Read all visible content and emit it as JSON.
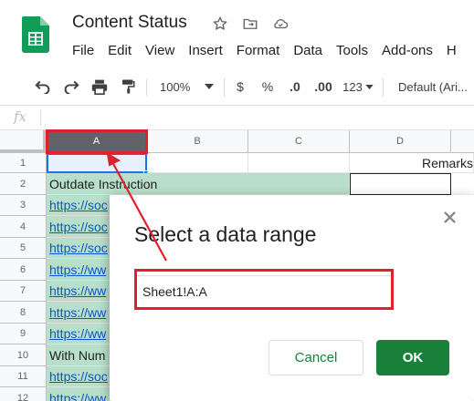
{
  "header": {
    "doc_title": "Content Status",
    "menu": [
      "File",
      "Edit",
      "View",
      "Insert",
      "Format",
      "Data",
      "Tools",
      "Add-ons",
      "H"
    ]
  },
  "toolbar": {
    "zoom": "100%",
    "currency": "$",
    "percent": "%",
    "decrease_decimal": ".0",
    "increase_decimal": ".00",
    "more_formats": "123",
    "font": "Default (Ari..."
  },
  "formula_bar": {
    "fx_label": "fx",
    "value": ""
  },
  "grid": {
    "columns": [
      "A",
      "B",
      "C",
      "D"
    ],
    "rows": [
      "1",
      "2",
      "3",
      "4",
      "5",
      "6",
      "7",
      "8",
      "9",
      "10",
      "11",
      "12"
    ],
    "cells": {
      "d1": "Remarks",
      "a2": "Outdate Instruction",
      "a3": "https://soc",
      "a4": "https://soc",
      "a5": "https://soc",
      "a6": "https://ww",
      "a7": "https://ww",
      "a8": "https://ww",
      "a9": "https://ww",
      "a10": "With Num",
      "a11": "https://soc",
      "a12": "https://ww"
    }
  },
  "dialog": {
    "title": "Select a data range",
    "range_value": "Sheet1!A:A",
    "cancel_label": "Cancel",
    "ok_label": "OK"
  },
  "colors": {
    "accent_green": "#188038",
    "annotation_red": "#e0202e",
    "selected_column_header": "#5f6368"
  }
}
